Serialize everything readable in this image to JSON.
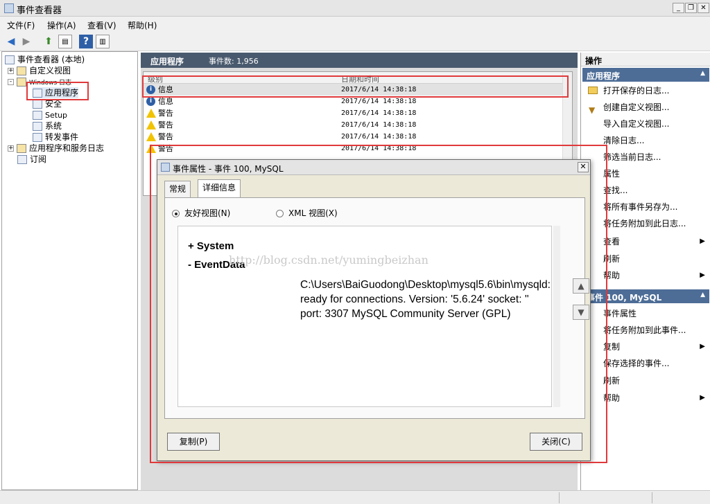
{
  "window": {
    "title": "事件查看器"
  },
  "menubar": [
    "文件(F)",
    "操作(A)",
    "查看(V)",
    "帮助(H)"
  ],
  "tree": {
    "root": "事件查看器 (本地)",
    "custom_views": "自定义视图",
    "windows_logs": "Windows 日志",
    "app": "应用程序",
    "security": "安全",
    "setup": "Setup",
    "system": "系统",
    "forwarded": "转发事件",
    "app_service_logs": "应用程序和服务日志",
    "subscriptions": "订阅"
  },
  "middle": {
    "title": "应用程序",
    "event_count": "事件数: 1,956",
    "col_level": "级别",
    "col_datetime": "日期和时间",
    "rows": [
      {
        "level": "信息",
        "type": "info",
        "datetime": "2017/6/14 14:38:18"
      },
      {
        "level": "信息",
        "type": "info",
        "datetime": "2017/6/14 14:38:18"
      },
      {
        "level": "警告",
        "type": "warn",
        "datetime": "2017/6/14 14:38:18"
      },
      {
        "level": "警告",
        "type": "warn",
        "datetime": "2017/6/14 14:38:18"
      },
      {
        "level": "警告",
        "type": "warn",
        "datetime": "2017/6/14 14:38:18"
      },
      {
        "level": "警告",
        "type": "warn",
        "datetime": "2017/6/14 14:38:18"
      }
    ]
  },
  "actions": {
    "header": "操作",
    "group1": "应用程序",
    "group1_items": [
      "打开保存的日志...",
      "创建自定义视图...",
      "导入自定义视图...",
      "清除日志...",
      "筛选当前日志...",
      "属性",
      "查找...",
      "将所有事件另存为...",
      "将任务附加到此日志...",
      "查看",
      "刷新",
      "帮助"
    ],
    "group2": "事件 100, MySQL",
    "group2_items": [
      "事件属性",
      "将任务附加到此事件...",
      "复制",
      "保存选择的事件...",
      "刷新",
      "帮助"
    ]
  },
  "dialog": {
    "title": "事件属性 - 事件 100, MySQL",
    "tab_general": "常规",
    "tab_details": "详细信息",
    "radio_friendly": "友好视图(N)",
    "radio_xml": "XML 视图(X)",
    "system": "+ System",
    "eventdata": "- EventData",
    "message": "C:\\Users\\BaiGuodong\\Desktop\\mysql5.6\\bin\\mysqld: ready for connections. Version: '5.6.24' socket: '' port: 3307 MySQL Community Server (GPL)",
    "copy_btn": "复制(P)",
    "close_btn": "关闭(C)"
  },
  "watermark": "http://blog.csdn.net/yumingbeizhan"
}
